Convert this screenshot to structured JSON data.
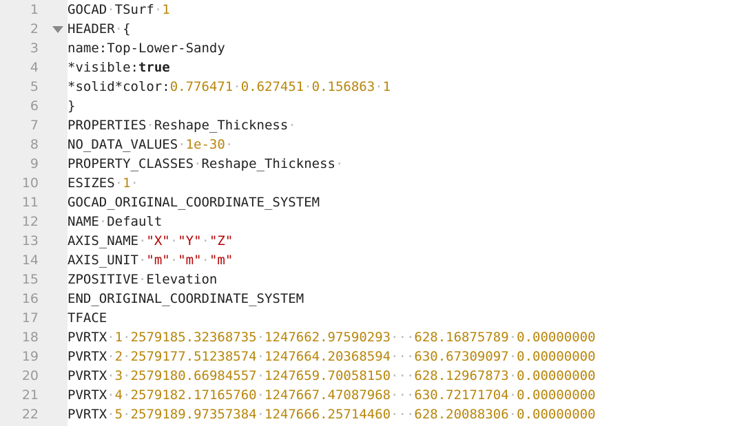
{
  "editor": {
    "lines": [
      {
        "n": "1",
        "parts": [
          [
            "t",
            "GOCAD"
          ],
          [
            "w",
            "·"
          ],
          [
            "t",
            "TSurf"
          ],
          [
            "w",
            "·"
          ],
          [
            "n",
            "1"
          ]
        ]
      },
      {
        "n": "2",
        "fold": true,
        "parts": [
          [
            "t",
            "HEADER"
          ],
          [
            "w",
            "·"
          ],
          [
            "t",
            "{"
          ]
        ]
      },
      {
        "n": "3",
        "parts": [
          [
            "t",
            "name:Top-Lower-Sandy"
          ]
        ]
      },
      {
        "n": "4",
        "parts": [
          [
            "t",
            "*visible:"
          ],
          [
            "k",
            "true"
          ]
        ]
      },
      {
        "n": "5",
        "parts": [
          [
            "t",
            "*solid*color:"
          ],
          [
            "n",
            "0.776471"
          ],
          [
            "w",
            "·"
          ],
          [
            "n",
            "0.627451"
          ],
          [
            "w",
            "·"
          ],
          [
            "n",
            "0.156863"
          ],
          [
            "w",
            "·"
          ],
          [
            "n",
            "1"
          ]
        ]
      },
      {
        "n": "6",
        "parts": [
          [
            "t",
            "}"
          ]
        ]
      },
      {
        "n": "7",
        "parts": [
          [
            "t",
            "PROPERTIES"
          ],
          [
            "w",
            "·"
          ],
          [
            "t",
            "Reshape_Thickness"
          ],
          [
            "w",
            "·"
          ]
        ]
      },
      {
        "n": "8",
        "parts": [
          [
            "t",
            "NO_DATA_VALUES"
          ],
          [
            "w",
            "·"
          ],
          [
            "n",
            "1e-30"
          ],
          [
            "w",
            "·"
          ]
        ]
      },
      {
        "n": "9",
        "parts": [
          [
            "t",
            "PROPERTY_CLASSES"
          ],
          [
            "w",
            "·"
          ],
          [
            "t",
            "Reshape_Thickness"
          ],
          [
            "w",
            "·"
          ]
        ]
      },
      {
        "n": "10",
        "parts": [
          [
            "t",
            "ESIZES"
          ],
          [
            "w",
            "·"
          ],
          [
            "n",
            "1"
          ],
          [
            "w",
            "·"
          ]
        ]
      },
      {
        "n": "11",
        "parts": [
          [
            "t",
            "GOCAD_ORIGINAL_COORDINATE_SYSTEM"
          ]
        ]
      },
      {
        "n": "12",
        "parts": [
          [
            "t",
            "NAME"
          ],
          [
            "w",
            "·"
          ],
          [
            "t",
            "Default"
          ]
        ]
      },
      {
        "n": "13",
        "parts": [
          [
            "t",
            "AXIS_NAME"
          ],
          [
            "w",
            "·"
          ],
          [
            "s",
            "\"X\""
          ],
          [
            "w",
            "·"
          ],
          [
            "s",
            "\"Y\""
          ],
          [
            "w",
            "·"
          ],
          [
            "s",
            "\"Z\""
          ]
        ]
      },
      {
        "n": "14",
        "parts": [
          [
            "t",
            "AXIS_UNIT"
          ],
          [
            "w",
            "·"
          ],
          [
            "s",
            "\"m\""
          ],
          [
            "w",
            "·"
          ],
          [
            "s",
            "\"m\""
          ],
          [
            "w",
            "·"
          ],
          [
            "s",
            "\"m\""
          ]
        ]
      },
      {
        "n": "15",
        "parts": [
          [
            "t",
            "ZPOSITIVE"
          ],
          [
            "w",
            "·"
          ],
          [
            "t",
            "Elevation"
          ]
        ]
      },
      {
        "n": "16",
        "parts": [
          [
            "t",
            "END_ORIGINAL_COORDINATE_SYSTEM"
          ]
        ]
      },
      {
        "n": "17",
        "parts": [
          [
            "t",
            "TFACE"
          ]
        ]
      },
      {
        "n": "18",
        "parts": [
          [
            "t",
            "PVRTX"
          ],
          [
            "w",
            "·"
          ],
          [
            "n",
            "1"
          ],
          [
            "w",
            "·"
          ],
          [
            "n",
            "2579185.32368735"
          ],
          [
            "w",
            "·"
          ],
          [
            "n",
            "1247662.97590293"
          ],
          [
            "w",
            "···"
          ],
          [
            "n",
            "628.16875789"
          ],
          [
            "w",
            "·"
          ],
          [
            "n",
            "0.00000000"
          ]
        ]
      },
      {
        "n": "19",
        "parts": [
          [
            "t",
            "PVRTX"
          ],
          [
            "w",
            "·"
          ],
          [
            "n",
            "2"
          ],
          [
            "w",
            "·"
          ],
          [
            "n",
            "2579177.51238574"
          ],
          [
            "w",
            "·"
          ],
          [
            "n",
            "1247664.20368594"
          ],
          [
            "w",
            "···"
          ],
          [
            "n",
            "630.67309097"
          ],
          [
            "w",
            "·"
          ],
          [
            "n",
            "0.00000000"
          ]
        ]
      },
      {
        "n": "20",
        "parts": [
          [
            "t",
            "PVRTX"
          ],
          [
            "w",
            "·"
          ],
          [
            "n",
            "3"
          ],
          [
            "w",
            "·"
          ],
          [
            "n",
            "2579180.66984557"
          ],
          [
            "w",
            "·"
          ],
          [
            "n",
            "1247659.70058150"
          ],
          [
            "w",
            "···"
          ],
          [
            "n",
            "628.12967873"
          ],
          [
            "w",
            "·"
          ],
          [
            "n",
            "0.00000000"
          ]
        ]
      },
      {
        "n": "21",
        "parts": [
          [
            "t",
            "PVRTX"
          ],
          [
            "w",
            "·"
          ],
          [
            "n",
            "4"
          ],
          [
            "w",
            "·"
          ],
          [
            "n",
            "2579182.17165760"
          ],
          [
            "w",
            "·"
          ],
          [
            "n",
            "1247667.47087968"
          ],
          [
            "w",
            "···"
          ],
          [
            "n",
            "630.72171704"
          ],
          [
            "w",
            "·"
          ],
          [
            "n",
            "0.00000000"
          ]
        ]
      },
      {
        "n": "22",
        "parts": [
          [
            "t",
            "PVRTX"
          ],
          [
            "w",
            "·"
          ],
          [
            "n",
            "5"
          ],
          [
            "w",
            "·"
          ],
          [
            "n",
            "2579189.97357384"
          ],
          [
            "w",
            "·"
          ],
          [
            "n",
            "1247666.25714460"
          ],
          [
            "w",
            "···"
          ],
          [
            "n",
            "628.20088306"
          ],
          [
            "w",
            "·"
          ],
          [
            "n",
            "0.00000000"
          ]
        ]
      }
    ]
  }
}
